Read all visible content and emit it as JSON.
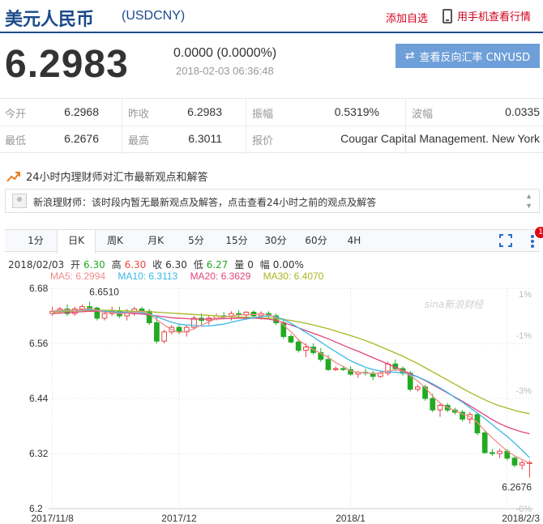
{
  "header": {
    "currency_name": "美元人民币",
    "currency_code": "(USDCNY)",
    "add_favorite": "添加自选",
    "mobile_quotes": "用手机查看行情"
  },
  "quote": {
    "price": "6.2983",
    "change": "0.0000 (0.0000%)",
    "timestamp": "2018-02-03 06:36:48",
    "reverse_button": "查看反向汇率 CNYUSD"
  },
  "stats": {
    "open_label": "今开",
    "open": "6.2968",
    "prev_close_label": "昨收",
    "prev_close": "6.2983",
    "amplitude_label": "振幅",
    "amplitude": "0.5319%",
    "volatility_label": "波幅",
    "volatility": "0.0335",
    "low_label": "最低",
    "low": "6.2676",
    "high_label": "最高",
    "high": "6.3011",
    "quote_label": "报价",
    "quote_source": "Cougar Capital Management. New York"
  },
  "news": {
    "title": "24小时内理财师对汇市最新观点和解答",
    "message": "新浪理财师：该时段内暂无最新观点及解答，点击查看24小时之前的观点及解答"
  },
  "tabs": [
    "1分",
    "日K",
    "周K",
    "月K",
    "5分",
    "15分",
    "30分",
    "60分",
    "4H"
  ],
  "active_tab": "日K",
  "badge_count": "1",
  "kline_info": {
    "date": "2018/02/03",
    "open_label": "开",
    "open": "6.30",
    "high_label": "高",
    "high": "6.30",
    "close_label": "收",
    "close": "6.30",
    "low_label": "低",
    "low": "6.27",
    "volume_label": "量",
    "volume": "0",
    "amplitude_label": "幅",
    "amplitude": "0.00%"
  },
  "ma_legend": {
    "ma5": "MA5: 6.2994",
    "ma10": "MA10: 6.3113",
    "ma20": "MA20: 6.3629",
    "ma30": "MA30: 6.4070"
  },
  "watermark": "sina新浪财经",
  "chart_data": {
    "type": "candlestick",
    "y_ticks": [
      "6.68",
      "6.56",
      "6.44",
      "6.32",
      "6.2"
    ],
    "y_tick_values": [
      6.68,
      6.56,
      6.44,
      6.32,
      6.2
    ],
    "pct_ticks": [
      "1%",
      "-1%",
      "-3%",
      "-6%"
    ],
    "pct_tick_values": [
      6.668,
      6.578,
      6.458,
      6.2
    ],
    "x_ticks": [
      "2017/11/8",
      "2017/12",
      "2018/1",
      "2018/2/3"
    ],
    "x_tick_index": [
      0,
      17,
      40,
      61
    ],
    "ylim": [
      6.2,
      6.68
    ],
    "annotations": [
      {
        "text": "6.6510",
        "index": 5,
        "value": 6.651,
        "position": "above"
      },
      {
        "text": "6.2676",
        "index": 62,
        "value": 6.2676,
        "position": "below"
      }
    ],
    "colors": {
      "up": "#e44444",
      "down": "#22aa22",
      "ma5": "#f08c8c",
      "ma10": "#39b8e6",
      "ma20": "#e0457b",
      "ma30": "#a8b820"
    },
    "candles": [
      [
        6.625,
        6.64,
        6.62,
        6.63
      ],
      [
        6.63,
        6.64,
        6.625,
        6.635
      ],
      [
        6.635,
        6.645,
        6.62,
        6.625
      ],
      [
        6.625,
        6.64,
        6.62,
        6.635
      ],
      [
        6.635,
        6.645,
        6.63,
        6.64
      ],
      [
        6.64,
        6.651,
        6.632,
        6.637
      ],
      [
        6.637,
        6.64,
        6.61,
        6.615
      ],
      [
        6.615,
        6.63,
        6.61,
        6.625
      ],
      [
        6.625,
        6.64,
        6.62,
        6.63
      ],
      [
        6.63,
        6.64,
        6.615,
        6.62
      ],
      [
        6.62,
        6.635,
        6.61,
        6.628
      ],
      [
        6.628,
        6.64,
        6.62,
        6.635
      ],
      [
        6.635,
        6.64,
        6.625,
        6.63
      ],
      [
        6.63,
        6.635,
        6.6,
        6.605
      ],
      [
        6.605,
        6.62,
        6.56,
        6.565
      ],
      [
        6.565,
        6.59,
        6.56,
        6.585
      ],
      [
        6.585,
        6.6,
        6.58,
        6.595
      ],
      [
        6.595,
        6.6,
        6.58,
        6.585
      ],
      [
        6.585,
        6.6,
        6.575,
        6.595
      ],
      [
        6.595,
        6.62,
        6.59,
        6.615
      ],
      [
        6.615,
        6.625,
        6.6,
        6.61
      ],
      [
        6.61,
        6.62,
        6.6,
        6.615
      ],
      [
        6.615,
        6.625,
        6.61,
        6.62
      ],
      [
        6.62,
        6.628,
        6.612,
        6.618
      ],
      [
        6.618,
        6.63,
        6.61,
        6.625
      ],
      [
        6.625,
        6.632,
        6.618,
        6.622
      ],
      [
        6.622,
        6.63,
        6.615,
        6.628
      ],
      [
        6.628,
        6.632,
        6.615,
        6.62
      ],
      [
        6.62,
        6.63,
        6.612,
        6.625
      ],
      [
        6.625,
        6.63,
        6.615,
        6.62
      ],
      [
        6.62,
        6.625,
        6.6,
        6.605
      ],
      [
        6.605,
        6.615,
        6.57,
        6.575
      ],
      [
        6.575,
        6.58,
        6.56,
        6.563
      ],
      [
        6.563,
        6.57,
        6.54,
        6.545
      ],
      [
        6.545,
        6.56,
        6.53,
        6.552
      ],
      [
        6.552,
        6.56,
        6.535,
        6.54
      ],
      [
        6.54,
        6.55,
        6.52,
        6.525
      ],
      [
        6.525,
        6.535,
        6.5,
        6.503
      ],
      [
        6.503,
        6.51,
        6.5,
        6.505
      ],
      [
        6.505,
        6.51,
        6.5,
        6.503
      ],
      [
        6.503,
        6.51,
        6.49,
        6.493
      ],
      [
        6.493,
        6.5,
        6.485,
        6.497
      ],
      [
        6.497,
        6.505,
        6.49,
        6.495
      ],
      [
        6.495,
        6.5,
        6.48,
        6.488
      ],
      [
        6.488,
        6.5,
        6.485,
        6.495
      ],
      [
        6.495,
        6.52,
        6.49,
        6.515
      ],
      [
        6.515,
        6.525,
        6.5,
        6.505
      ],
      [
        6.505,
        6.51,
        6.49,
        6.495
      ],
      [
        6.495,
        6.5,
        6.455,
        6.46
      ],
      [
        6.46,
        6.47,
        6.455,
        6.465
      ],
      [
        6.465,
        6.47,
        6.435,
        6.44
      ],
      [
        6.44,
        6.45,
        6.41,
        6.415
      ],
      [
        6.415,
        6.43,
        6.4,
        6.425
      ],
      [
        6.425,
        6.43,
        6.41,
        6.415
      ],
      [
        6.415,
        6.42,
        6.405,
        6.41
      ],
      [
        6.41,
        6.415,
        6.39,
        6.395
      ],
      [
        6.395,
        6.41,
        6.385,
        6.405
      ],
      [
        6.405,
        6.41,
        6.36,
        6.365
      ],
      [
        6.365,
        6.37,
        6.32,
        6.322
      ],
      [
        6.322,
        6.33,
        6.315,
        6.32
      ],
      [
        6.32,
        6.33,
        6.31,
        6.325
      ],
      [
        6.325,
        6.33,
        6.305,
        6.31
      ],
      [
        6.31,
        6.315,
        6.29,
        6.295
      ],
      [
        6.295,
        6.305,
        6.285,
        6.3
      ],
      [
        6.3,
        6.305,
        6.2676,
        6.3
      ]
    ],
    "ma5_values": [
      6.63,
      6.632,
      6.633,
      6.632,
      6.634,
      6.636,
      6.632,
      6.628,
      6.627,
      6.625,
      6.626,
      6.628,
      6.63,
      6.624,
      6.612,
      6.6,
      6.59,
      6.584,
      6.586,
      6.592,
      6.6,
      6.607,
      6.614,
      6.617,
      6.62,
      6.622,
      6.623,
      6.623,
      6.624,
      6.622,
      6.616,
      6.6,
      6.585,
      6.568,
      6.556,
      6.547,
      6.538,
      6.53,
      6.518,
      6.51,
      6.5,
      6.497,
      6.496,
      6.494,
      6.496,
      6.5,
      6.502,
      6.5,
      6.49,
      6.478,
      6.464,
      6.445,
      6.43,
      6.42,
      6.414,
      6.406,
      6.4,
      6.388,
      6.37,
      6.354,
      6.34,
      6.325,
      6.315,
      6.307,
      6.299
    ],
    "ma10_values": [
      6.63,
      6.631,
      6.632,
      6.632,
      6.633,
      6.634,
      6.632,
      6.63,
      6.629,
      6.628,
      6.628,
      6.628,
      6.627,
      6.624,
      6.618,
      6.612,
      6.606,
      6.602,
      6.6,
      6.599,
      6.598,
      6.598,
      6.6,
      6.602,
      6.606,
      6.61,
      6.613,
      6.616,
      6.618,
      6.62,
      6.618,
      6.612,
      6.604,
      6.594,
      6.584,
      6.574,
      6.563,
      6.552,
      6.542,
      6.532,
      6.522,
      6.515,
      6.508,
      6.503,
      6.5,
      6.498,
      6.497,
      6.496,
      6.492,
      6.487,
      6.48,
      6.472,
      6.463,
      6.453,
      6.442,
      6.432,
      6.42,
      6.408,
      6.396,
      6.383,
      6.37,
      6.357,
      6.343,
      6.327,
      6.311
    ],
    "ma20_values": [
      6.625,
      6.626,
      6.627,
      6.628,
      6.629,
      6.63,
      6.63,
      6.629,
      6.628,
      6.627,
      6.626,
      6.625,
      6.624,
      6.622,
      6.62,
      6.618,
      6.616,
      6.615,
      6.614,
      6.613,
      6.613,
      6.613,
      6.613,
      6.614,
      6.614,
      6.615,
      6.615,
      6.615,
      6.614,
      6.613,
      6.61,
      6.605,
      6.6,
      6.594,
      6.588,
      6.582,
      6.576,
      6.57,
      6.563,
      6.556,
      6.549,
      6.543,
      6.536,
      6.529,
      6.522,
      6.515,
      6.508,
      6.501,
      6.494,
      6.487,
      6.479,
      6.47,
      6.461,
      6.452,
      6.443,
      6.434,
      6.424,
      6.414,
      6.404,
      6.394,
      6.385,
      6.378,
      6.372,
      6.367,
      6.363
    ],
    "ma30_values": [
      6.628,
      6.629,
      6.63,
      6.631,
      6.632,
      6.632,
      6.632,
      6.632,
      6.632,
      6.631,
      6.631,
      6.63,
      6.63,
      6.629,
      6.628,
      6.627,
      6.626,
      6.625,
      6.624,
      6.623,
      6.622,
      6.621,
      6.62,
      6.619,
      6.618,
      6.617,
      6.617,
      6.616,
      6.615,
      6.615,
      6.614,
      6.612,
      6.61,
      6.607,
      6.604,
      6.6,
      6.596,
      6.592,
      6.587,
      6.582,
      6.577,
      6.572,
      6.566,
      6.56,
      6.553,
      6.546,
      6.539,
      6.532,
      6.524,
      6.516,
      6.507,
      6.498,
      6.489,
      6.48,
      6.471,
      6.462,
      6.453,
      6.445,
      6.437,
      6.43,
      6.424,
      6.419,
      6.414,
      6.41,
      6.407
    ]
  }
}
